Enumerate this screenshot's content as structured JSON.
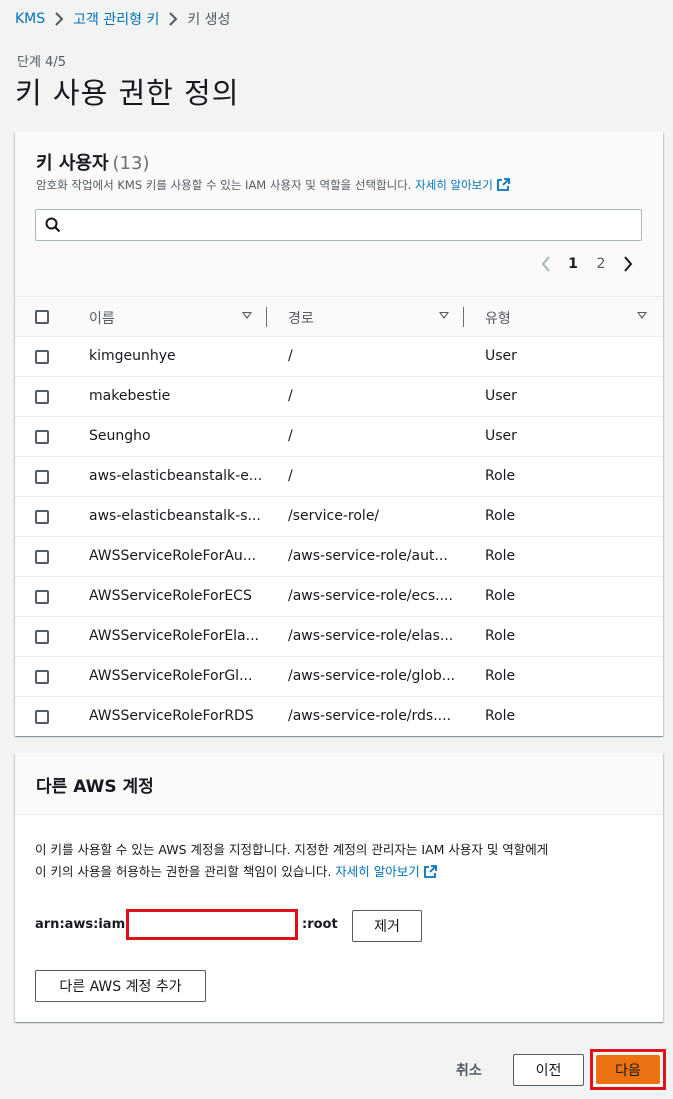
{
  "breadcrumb": {
    "items": [
      "KMS",
      "고객 관리형 키",
      "키 생성"
    ]
  },
  "step": "단계 4/5",
  "page_title": "키 사용 권한 정의",
  "users": {
    "title": "키 사용자",
    "count": "(13)",
    "description": "암호화 작업에서 KMS 키를 사용할 수 있는 IAM 사용자 및 역할을 선택합니다.",
    "learn_more": "자세히 알아보기",
    "search_placeholder": "",
    "pages": [
      "1",
      "2"
    ],
    "current_page": "1",
    "columns": [
      "이름",
      "경로",
      "유형"
    ],
    "rows": [
      {
        "name": "kimgeunhye",
        "path": "/",
        "type": "User"
      },
      {
        "name": "makebestie",
        "path": "/",
        "type": "User"
      },
      {
        "name": "Seungho",
        "path": "/",
        "type": "User"
      },
      {
        "name": "aws-elasticbeanstalk-e...",
        "path": "/",
        "type": "Role"
      },
      {
        "name": "aws-elasticbeanstalk-s...",
        "path": "/service-role/",
        "type": "Role"
      },
      {
        "name": "AWSServiceRoleForAu...",
        "path": "/aws-service-role/aut...",
        "type": "Role"
      },
      {
        "name": "AWSServiceRoleForECS",
        "path": "/aws-service-role/ecs....",
        "type": "Role"
      },
      {
        "name": "AWSServiceRoleForEla...",
        "path": "/aws-service-role/elas...",
        "type": "Role"
      },
      {
        "name": "AWSServiceRoleForGl...",
        "path": "/aws-service-role/glob...",
        "type": "Role"
      },
      {
        "name": "AWSServiceRoleForRDS",
        "path": "/aws-service-role/rds....",
        "type": "Role"
      }
    ]
  },
  "accounts": {
    "title": "다른 AWS 계정",
    "desc_line1": "이 키를 사용할 수 있는 AWS 계정을 지정합니다. 지정한 계정의 관리자는 IAM 사용자 및 역할에게",
    "desc_line2": "이 키의 사용을 허용하는 권한을 관리할 책임이 있습니다.",
    "learn_more": "자세히 알아보기",
    "arn_prefix": "arn:aws:iam::",
    "account_id_value": "",
    "arn_suffix": ":root",
    "remove_label": "제거",
    "add_label": "다른 AWS 계정 추가"
  },
  "footer": {
    "cancel_label": "취소",
    "prev_label": "이전",
    "next_label": "다음"
  },
  "colors": {
    "link": "#0073bb",
    "primary": "#ec7211",
    "highlight": "#e0101b"
  }
}
